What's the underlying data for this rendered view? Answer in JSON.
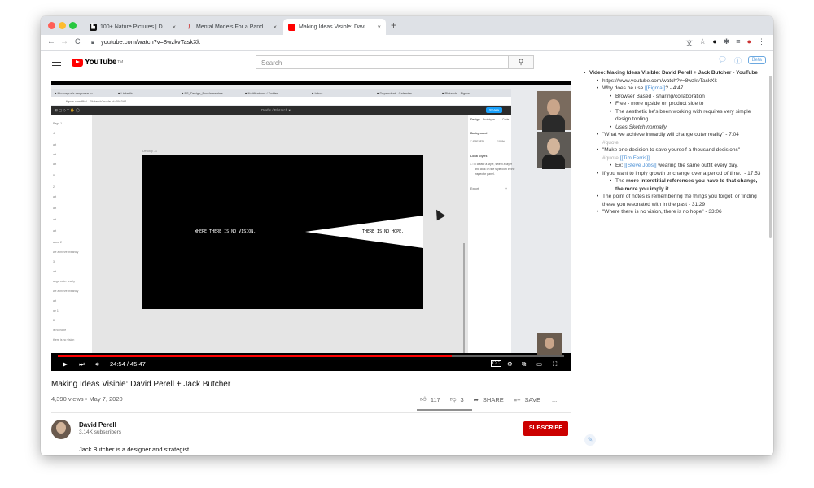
{
  "browser": {
    "tabs": [
      {
        "title": "100+ Nature Pictures | Downlo",
        "close": "×"
      },
      {
        "title": "Mental Models For a Pandemic",
        "close": "×"
      },
      {
        "title": "Making Ideas Visible: David Pe",
        "close": "×"
      }
    ],
    "new_tab": "+",
    "url": "youtube.com/watch?v=8wzkvTaskXk",
    "nav": {
      "back": "←",
      "forward": "→",
      "reload": "C"
    }
  },
  "youtube": {
    "logo_text": "YouTube",
    "logo_tm": "TM",
    "search_placeholder": "Search",
    "player": {
      "time": "24:54 / 45:47",
      "progress_fraction": 0.778,
      "slide_text_left": "WHERE THERE IS NO VISION.",
      "slide_text_right": "THERE IS NO HOPE."
    },
    "video_title": "Making Ideas Visible: David Perell + Jack Butcher",
    "video_meta": "4,390 views • May 7, 2020",
    "likes": "117",
    "dislikes": "3",
    "share_label": "SHARE",
    "save_label": "SAVE",
    "more_label": "...",
    "channel_name": "David Perell",
    "subscribers": "3.14K subscribers",
    "subscribe_label": "SUBSCRIBE",
    "description": "Jack Butcher is a designer and strategist."
  },
  "notes": {
    "beta_label": "Beta",
    "header": "Video: Making Ideas Visible: David Perell + Jack Butcher - YouTube",
    "url": "https://www.youtube.com/watch?v=8wzkvTaskXk",
    "q1_pre": "Why does he use ",
    "q1_link": "[[Figma]]",
    "q1_post": "? - 4:47",
    "figma_points": [
      "Browser Based - sharing/collaboration",
      "Free - more upside on product side to",
      "The aesthetic he's been working with requires very simple design tooling"
    ],
    "sketch_note": "Uses Sketch normally",
    "quote1": "\"What we achieve inwardly will change outer reality\" - 7:04",
    "quote_tag": "#quote",
    "quote2": "\"Make one decision to save yourself a thousand decisions\"",
    "quote2_link": "[[Tim Ferris]]",
    "ex_pre": "Ex: ",
    "ex_link": "[[Steve Jobs]]",
    "ex_post": " wearing the same outfit every day.",
    "imply": "If you want to imply growth or change over a period of time.. - 17:53",
    "imply_sub_pre": "The ",
    "imply_sub_bold": "more interstitial references you have to that change, the more you imply it.",
    "point_notes": "The point of notes is remembering the things you forgot, or finding these you resonated with in the past - 31:29",
    "vision_quote": "\"Where there is no vision, there is no hope\"  - 33:06"
  },
  "colors": {
    "youtube_red": "#ff0000",
    "subscribe_red": "#cc0000",
    "link_blue": "#4a8fd4"
  }
}
